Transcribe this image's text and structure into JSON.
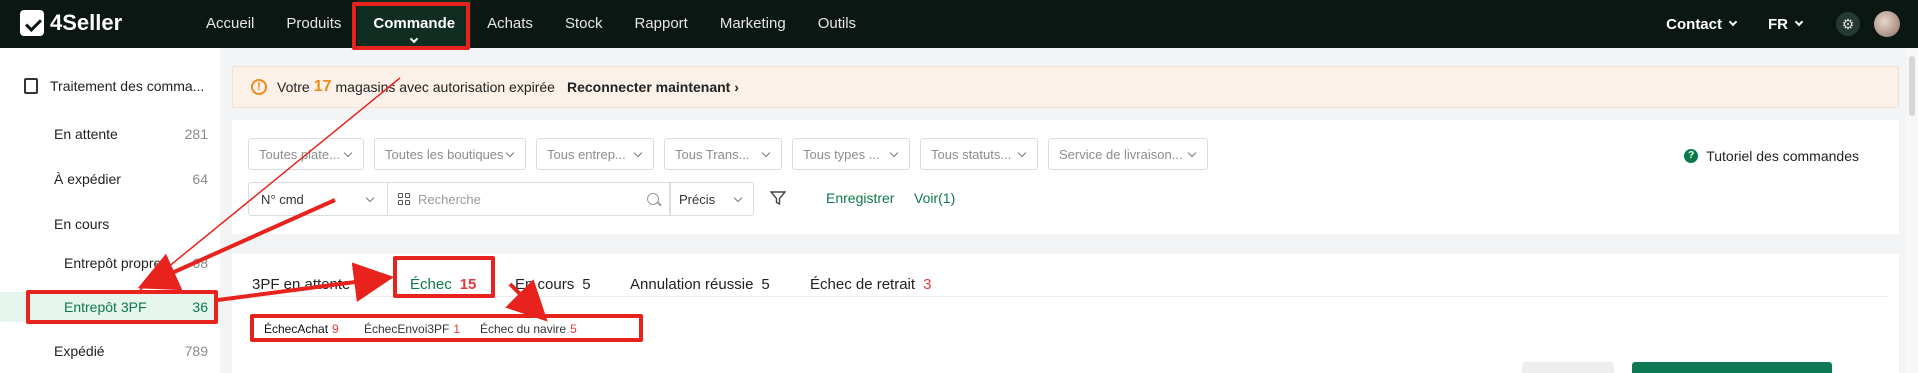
{
  "brand": {
    "name": "4Seller"
  },
  "nav": {
    "items": [
      "Accueil",
      "Produits",
      "Commande",
      "Achats",
      "Stock",
      "Rapport",
      "Marketing",
      "Outils"
    ],
    "active": "Commande",
    "contact": "Contact",
    "language": "FR",
    "icons": [
      "settings-icon",
      "avatar"
    ]
  },
  "sidebar": {
    "title": "Traitement des comma...",
    "items": [
      {
        "label": "En attente",
        "count": "281"
      },
      {
        "label": "À expédier",
        "count": "64"
      },
      {
        "label": "En cours",
        "count": ""
      },
      {
        "label": "Entrepôt propre",
        "count": "68"
      },
      {
        "label": "Entrepôt 3PF",
        "count": "36"
      },
      {
        "label": "Expédié",
        "count": "789"
      }
    ],
    "active": "Entrepôt 3PF"
  },
  "banner": {
    "prefix": "Votre",
    "count": "17",
    "suffix": "magasins avec autorisation expirée",
    "action": "Reconnecter maintenant",
    "accent": "#f08a1a"
  },
  "filters": {
    "selects": [
      "Toutes plate...",
      "Toutes les boutiques",
      "Tous entrep...",
      "Tous Trans...",
      "Tous types ...",
      "Tous statuts...",
      "Service de livraison..."
    ],
    "order_field": "N° cmd",
    "search_placeholder": "Recherche",
    "match_mode": "Précis",
    "save_label": "Enregistrer",
    "view_label": "Voir(1)",
    "tutorial": "Tutoriel des commandes"
  },
  "tabs": [
    {
      "label": "3PF en attente",
      "count": ""
    },
    {
      "label": "Échec",
      "count": "15"
    },
    {
      "label": "En cours",
      "count": "5"
    },
    {
      "label": "Annulation réussie",
      "count": "5"
    },
    {
      "label": "Échec de retrait",
      "count": "3"
    }
  ],
  "active_tab": "Échec",
  "subtabs": [
    {
      "label": "ÉchecAchat",
      "count": "9"
    },
    {
      "label": "ÉchecEnvoi3PF",
      "count": "1"
    },
    {
      "label": "Échec du navire",
      "count": "5"
    }
  ],
  "colors": {
    "brand_green": "#0b7a4b",
    "nav_bg": "#0b1712",
    "annotation_red": "#e8221c",
    "count_red": "#e5383b"
  }
}
